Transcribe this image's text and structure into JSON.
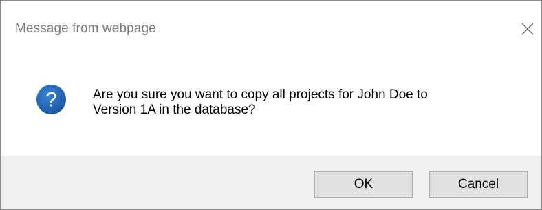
{
  "dialog": {
    "title": "Message from webpage",
    "close_icon": "close-icon",
    "icon": "question-icon",
    "message_line1": "Are you sure you want to copy all projects for John Doe to",
    "message_line2": "Version 1A in the database?",
    "ok_label": "OK",
    "cancel_label": "Cancel"
  },
  "colors": {
    "icon_blue": "#1d5ea8",
    "footer_bg": "#f0f0f0",
    "button_bg": "#e1e1e1"
  }
}
